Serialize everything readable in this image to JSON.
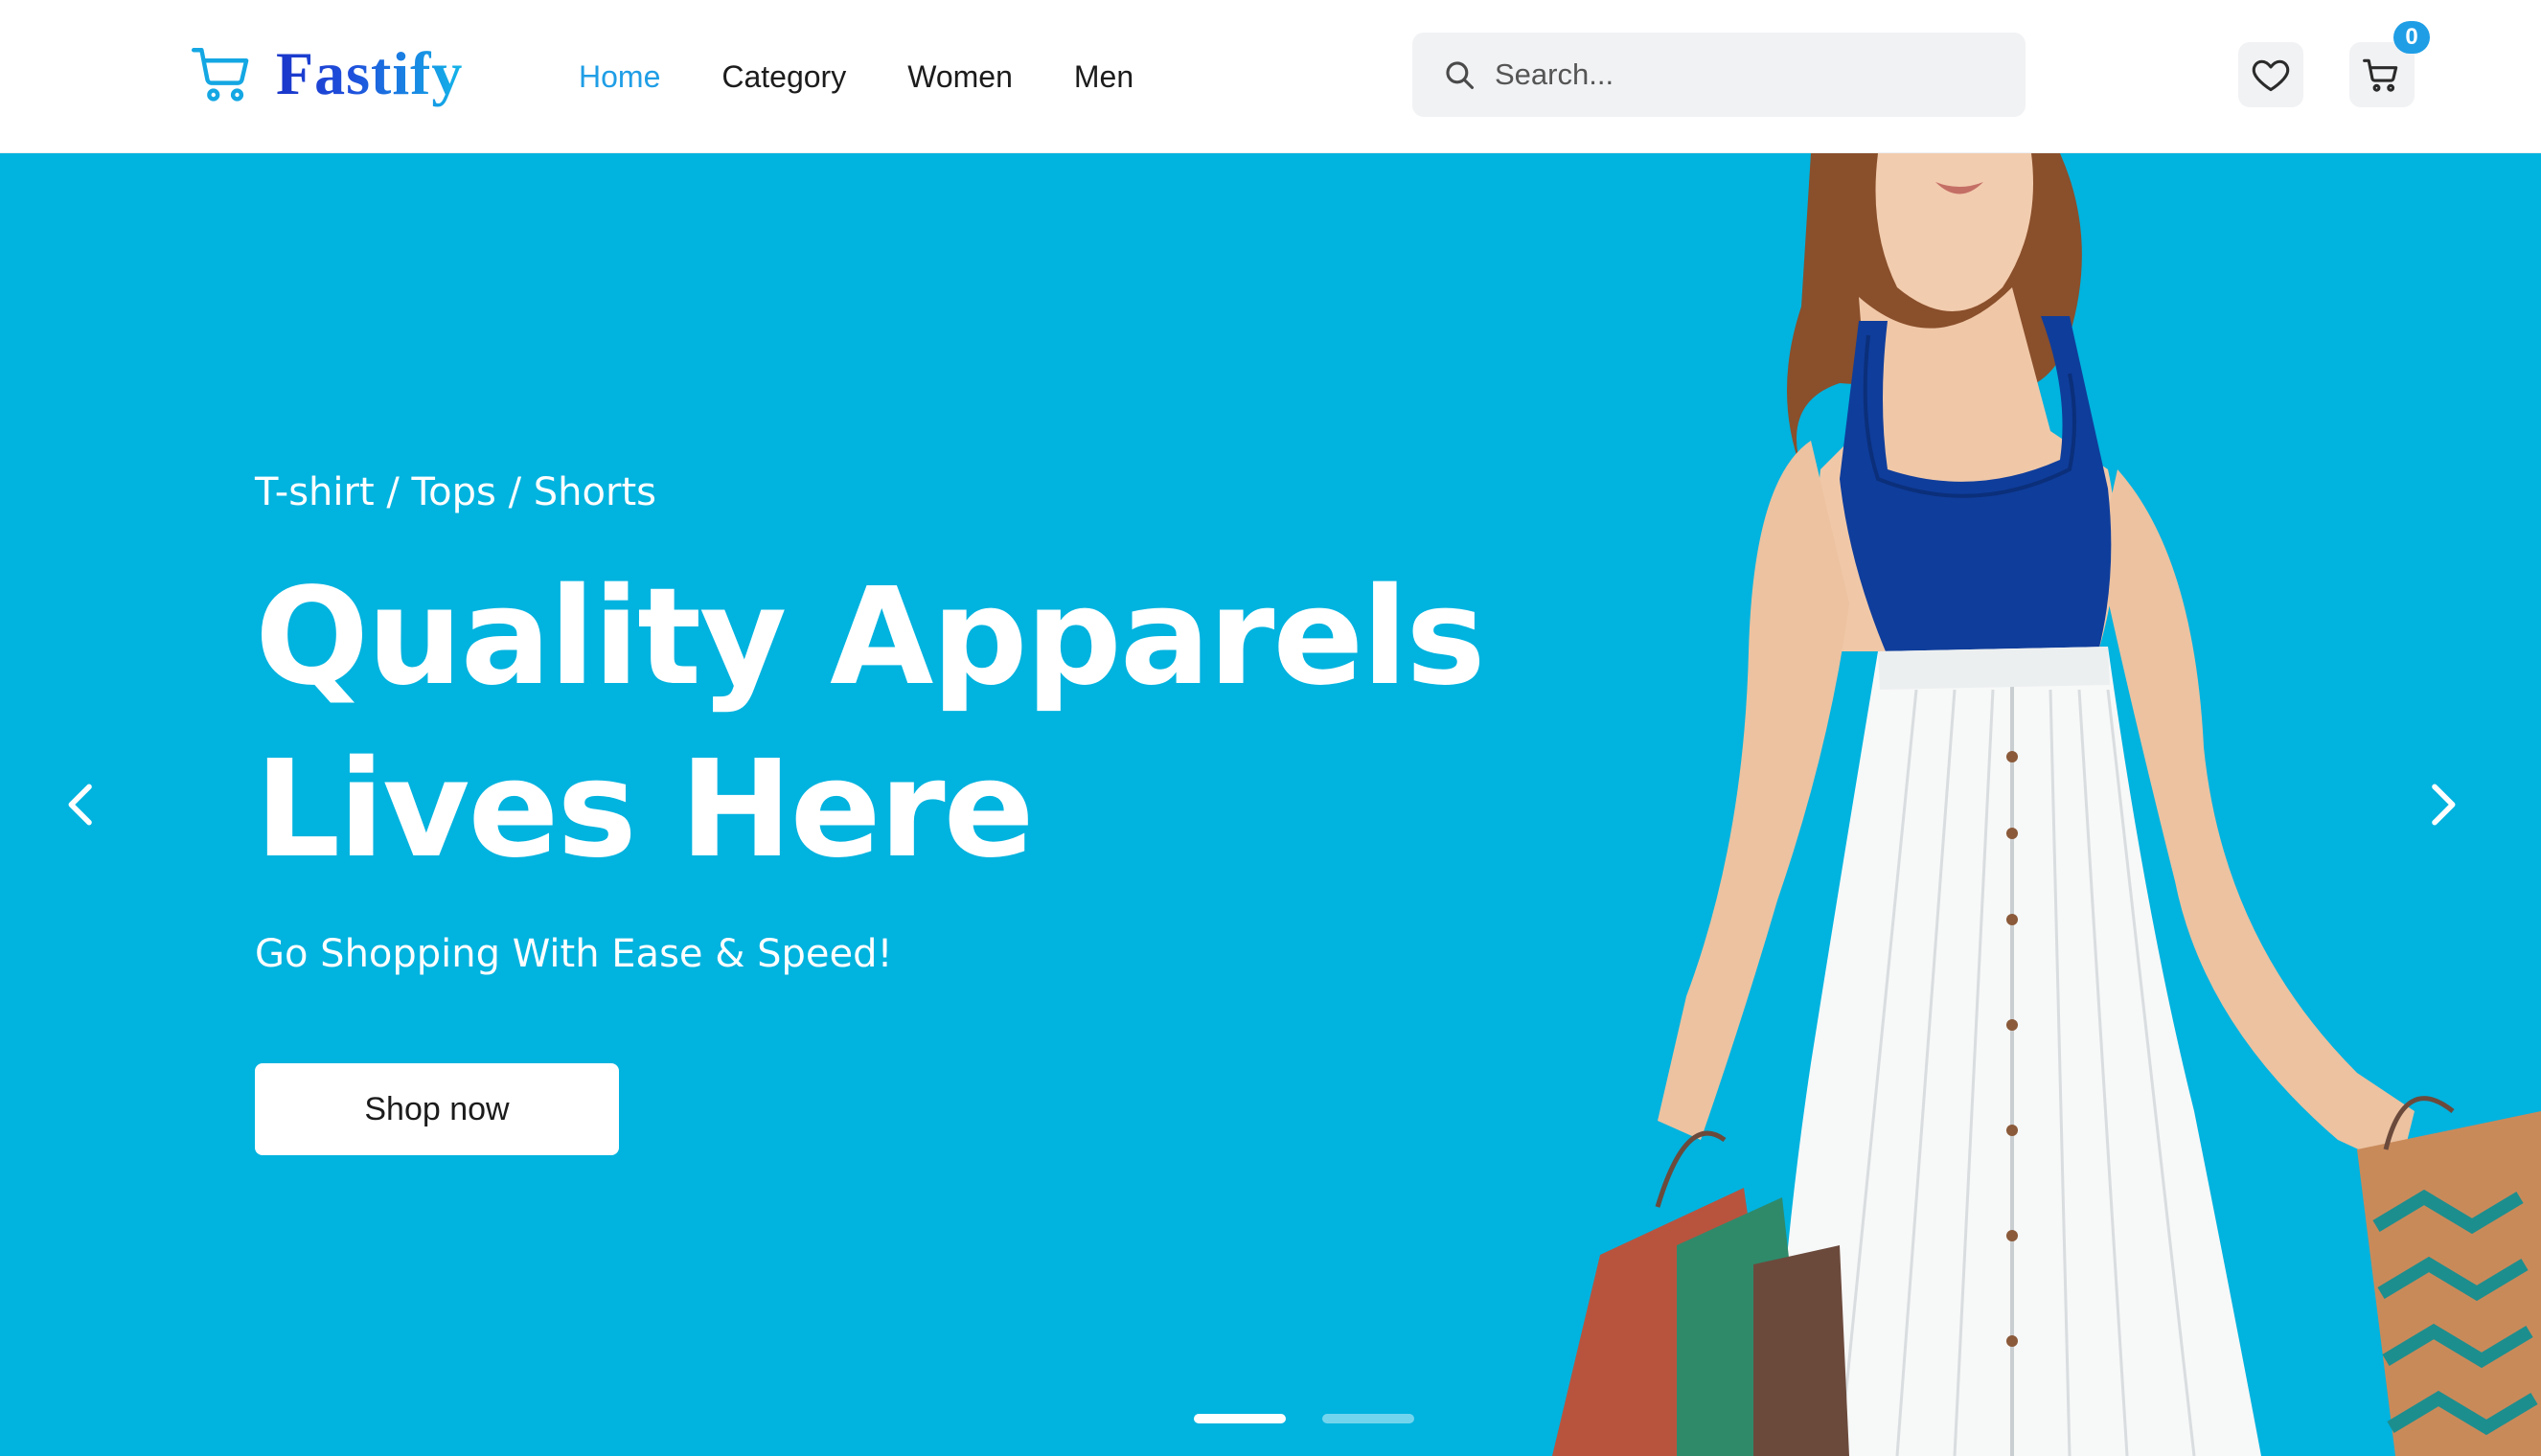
{
  "brand": {
    "name": "Fastify",
    "logo_icon": "shopping-cart-icon",
    "gradient_colors": [
      "#1a35c9",
      "#13b6e9"
    ]
  },
  "nav": {
    "items": [
      {
        "label": "Home",
        "active": true
      },
      {
        "label": "Category",
        "active": false
      },
      {
        "label": "Women",
        "active": false
      },
      {
        "label": "Men",
        "active": false
      }
    ]
  },
  "search": {
    "placeholder": "Search...",
    "value": ""
  },
  "actions": {
    "wishlist_icon": "heart-icon",
    "cart_icon": "shopping-cart-icon",
    "cart_count": "0"
  },
  "hero": {
    "eyebrow": "T-shirt / Tops / Shorts",
    "title_line1": "Quality Apparels",
    "title_line2": "Lives Here",
    "subtitle": "Go Shopping With Ease & Speed!",
    "cta_label": "Shop now",
    "background_color": "#01b3df",
    "slides_total": 2,
    "active_slide": 1
  },
  "colors": {
    "accent": "#1f9ee6",
    "text": "#1c1c1c",
    "surface": "#f1f2f4"
  }
}
